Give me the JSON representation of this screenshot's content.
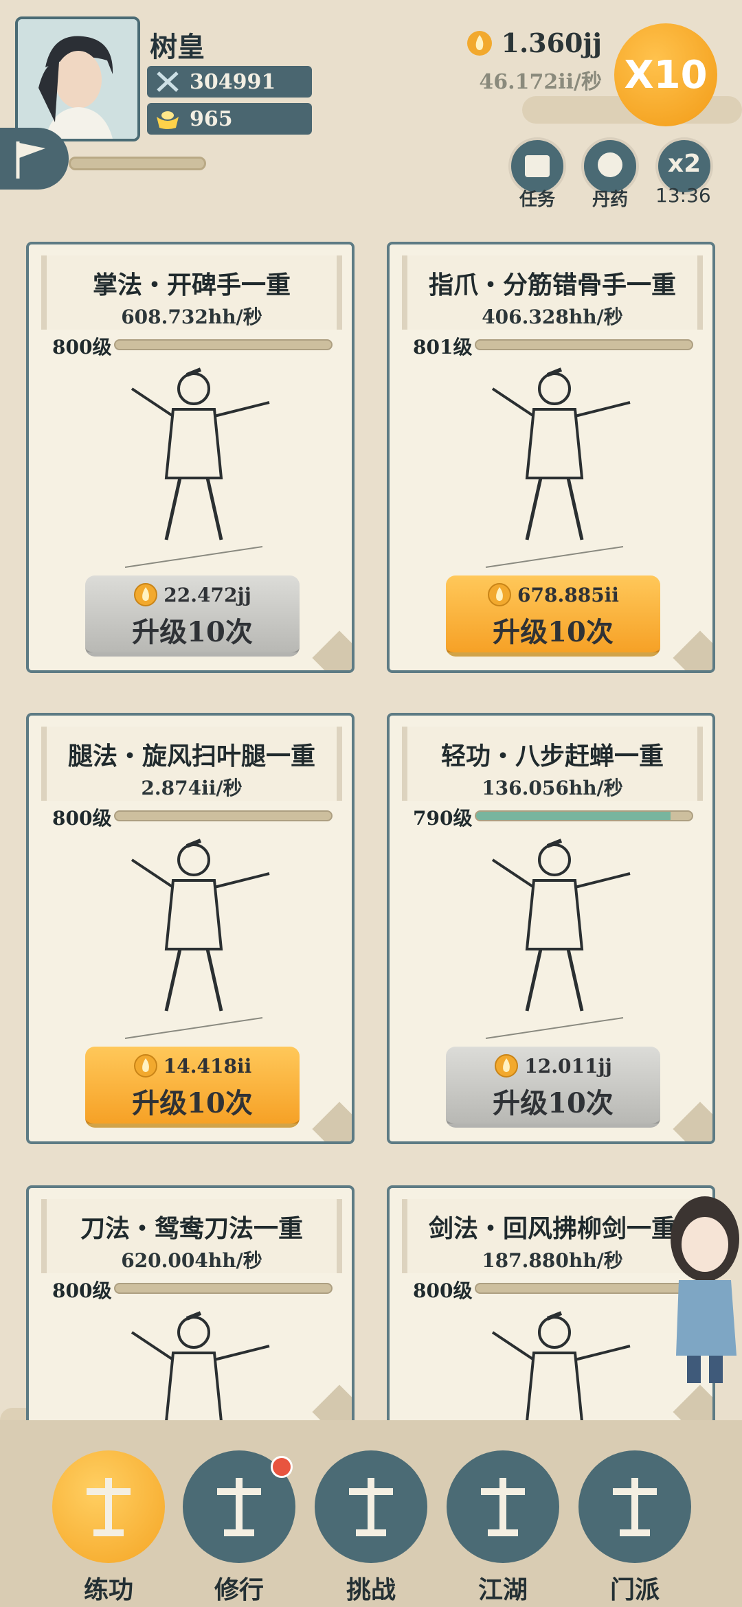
{
  "header": {
    "player_name": "树皇",
    "power": "304991",
    "gold": "965",
    "coins": "1.360jj",
    "coin_rate": "46.172ii/秒",
    "multiplier_label": "X10",
    "buttons": [
      {
        "label": "任务",
        "icon": "scroll-icon"
      },
      {
        "label": "丹药",
        "icon": "pill-icon"
      },
      {
        "label": "x2",
        "icon": "boost-icon"
      }
    ],
    "boost_timer": "13:36"
  },
  "cards": [
    {
      "title": "掌法・开碑手一重",
      "rate": "608.732hh/秒",
      "level": "800级",
      "progress": 0.0,
      "cost": "22.472jj",
      "button": "升级10次",
      "button_state": "gray"
    },
    {
      "title": "指爪・分筋错骨手一重",
      "rate": "406.328hh/秒",
      "level": "801级",
      "progress": 0.0,
      "cost": "678.885ii",
      "button": "升级10次",
      "button_state": "orange"
    },
    {
      "title": "腿法・旋风扫叶腿一重",
      "rate": "2.874ii/秒",
      "level": "800级",
      "progress": 0.0,
      "cost": "14.418ii",
      "button": "升级10次",
      "button_state": "orange"
    },
    {
      "title": "轻功・八步赶蝉一重",
      "rate": "136.056hh/秒",
      "level": "790级",
      "progress": 0.9,
      "cost": "12.011jj",
      "button": "升级10次",
      "button_state": "gray"
    },
    {
      "title": "刀法・鸳鸯刀法一重",
      "rate": "620.004hh/秒",
      "level": "800级",
      "progress": 0.0
    },
    {
      "title": "剑法・回风拂柳剑一重",
      "rate": "187.880hh/秒",
      "level": "800级",
      "progress": 0.0
    }
  ],
  "nav": [
    {
      "label": "练功",
      "active": true
    },
    {
      "label": "修行",
      "active": false,
      "badge": true
    },
    {
      "label": "挑战",
      "active": false
    },
    {
      "label": "江湖",
      "active": false
    },
    {
      "label": "门派",
      "active": false
    }
  ],
  "colors": {
    "accent": "#f5a524",
    "panel": "#4a6670",
    "paper": "#f6f1e3"
  }
}
